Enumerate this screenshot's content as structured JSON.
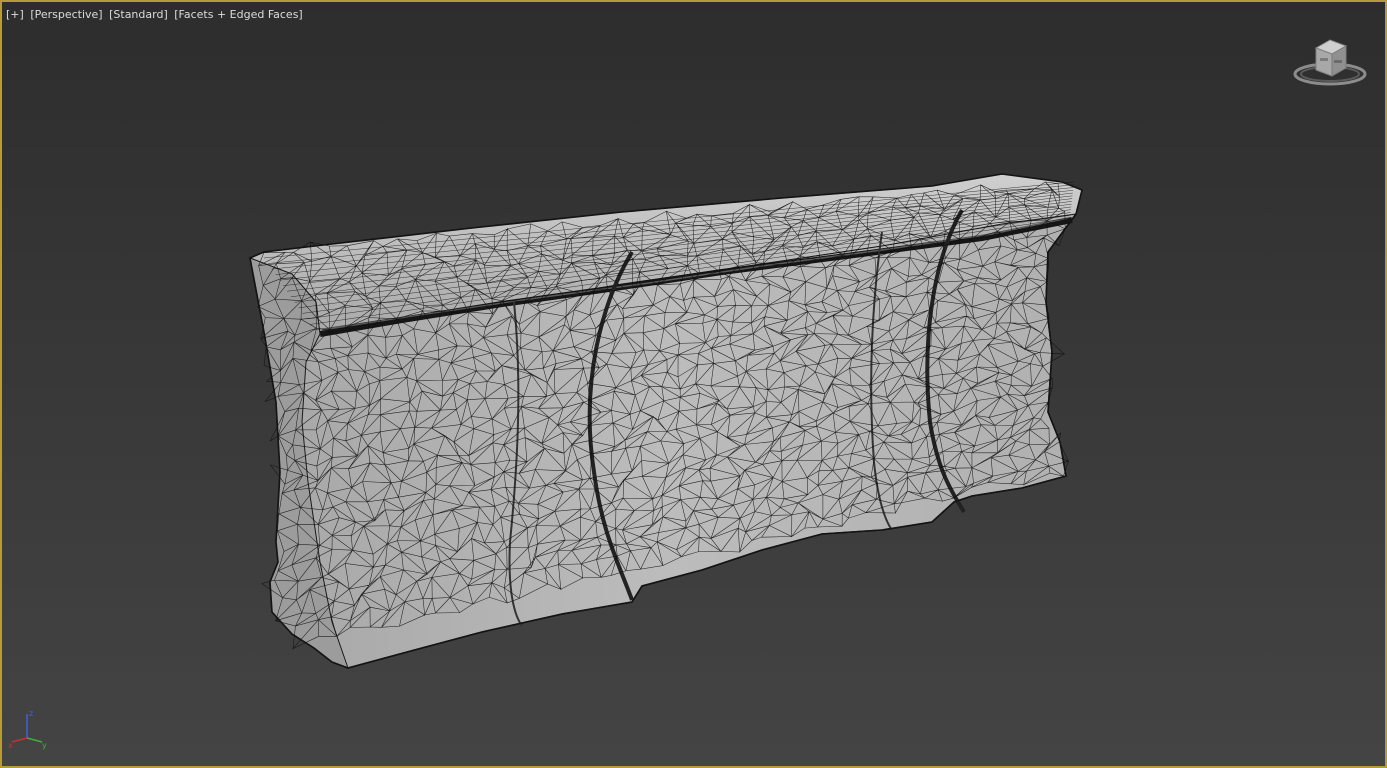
{
  "viewport": {
    "labels": {
      "plus": "[+]",
      "view": "[Perspective]",
      "shading_preset": "[Standard]",
      "display_mode": "[Facets + Edged Faces]"
    },
    "active_border_color": "#b79a3a",
    "background_top_color": "#2d2d2d",
    "background_bottom_color": "#444444",
    "mesh_fill_color": "#b4b4b4",
    "wire_color": "#111111"
  },
  "viewcube": {
    "icon": "viewcube-icon"
  },
  "axis_tripod": {
    "icon": "axis-tripod-icon",
    "x_label": "x",
    "y_label": "y",
    "z_label": "z",
    "x_color": "#c83030",
    "y_color": "#3fae3f",
    "z_color": "#3f62d8"
  }
}
